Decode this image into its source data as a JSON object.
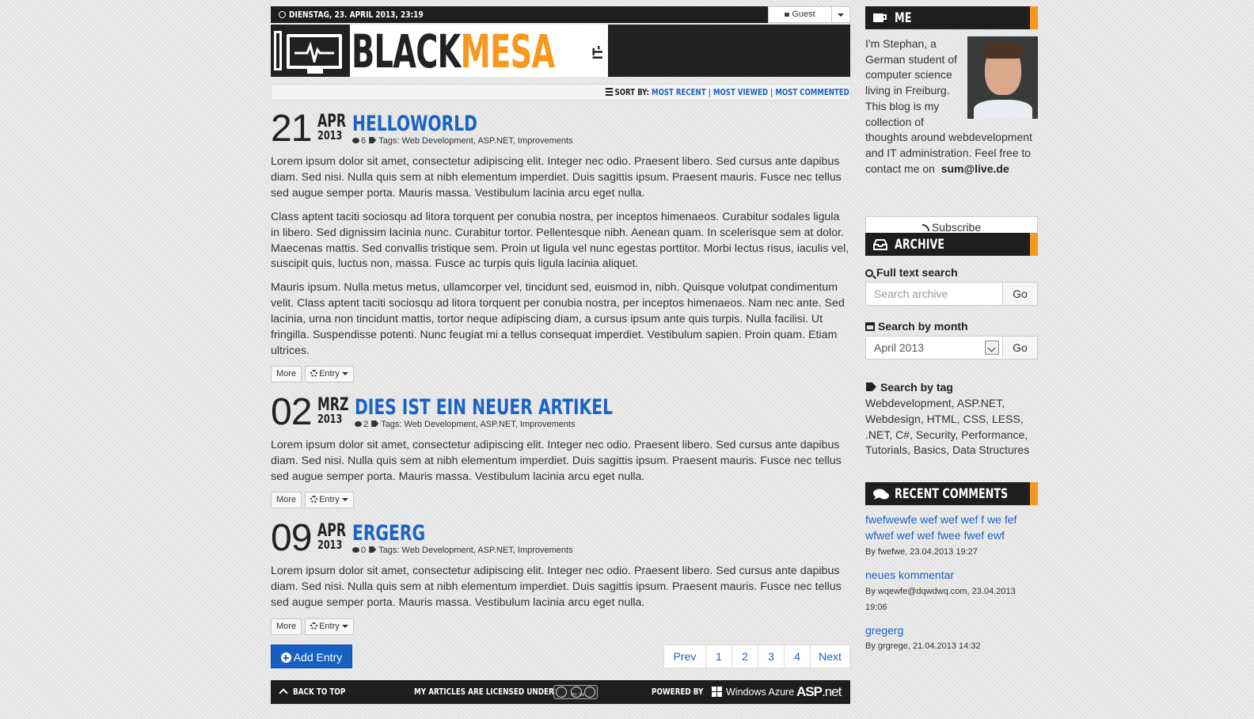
{
  "topbar": {
    "datetime": "DIENSTAG, 23. APRIL 2013, 23:19",
    "user": "Guest"
  },
  "logo": {
    "part1": "BLACK",
    "part2": "MESA",
    "tagline": "IT-BLOG"
  },
  "sort": {
    "label": "SORT BY:",
    "options": [
      "MOST RECENT",
      "MOST VIEWED",
      "MOST COMMENTED"
    ]
  },
  "posts": [
    {
      "day": "21",
      "month": "APR",
      "year": "2013",
      "title": "HELLOWORLD",
      "comments": "6",
      "tags_label": "Tags:",
      "tags": "Web Development, ASP.NET, Improvements",
      "paragraphs": [
        "Lorem ipsum dolor sit amet, consectetur adipiscing elit. Integer nec odio. Praesent libero. Sed cursus ante dapibus diam. Sed nisi. Nulla quis sem at nibh elementum imperdiet. Duis sagittis ipsum. Praesent mauris. Fusce nec tellus sed augue semper porta. Mauris massa. Vestibulum lacinia arcu eget nulla.",
        "Class aptent taciti sociosqu ad litora torquent per conubia nostra, per inceptos himenaeos. Curabitur sodales ligula in libero. Sed dignissim lacinia nunc. Curabitur tortor. Pellentesque nibh. Aenean quam. In scelerisque sem at dolor. Maecenas mattis. Sed convallis tristique sem. Proin ut ligula vel nunc egestas porttitor. Morbi lectus risus, iaculis vel, suscipit quis, luctus non, massa. Fusce ac turpis quis ligula lacinia aliquet.",
        "Mauris ipsum. Nulla metus metus, ullamcorper vel, tincidunt sed, euismod in, nibh. Quisque volutpat condimentum velit. Class aptent taciti sociosqu ad litora torquent per conubia nostra, per inceptos himenaeos. Nam nec ante. Sed lacinia, urna non tincidunt mattis, tortor neque adipiscing diam, a cursus ipsum ante quis turpis. Nulla facilisi. Ut fringilla. Suspendisse potenti. Nunc feugiat mi a tellus consequat imperdiet. Vestibulum sapien. Proin quam. Etiam ultrices."
      ],
      "more_label": "More",
      "entry_label": "Entry"
    },
    {
      "day": "02",
      "month": "MRZ",
      "year": "2013",
      "title": "DIES IST EIN NEUER ARTIKEL",
      "comments": "2",
      "tags_label": "Tags:",
      "tags": "Web Development, ASP.NET, Improvements",
      "paragraphs": [
        "Lorem ipsum dolor sit amet, consectetur adipiscing elit. Integer nec odio. Praesent libero. Sed cursus ante dapibus diam. Sed nisi. Nulla quis sem at nibh elementum imperdiet. Duis sagittis ipsum. Praesent mauris. Fusce nec tellus sed augue semper porta. Mauris massa. Vestibulum lacinia arcu eget nulla."
      ],
      "more_label": "More",
      "entry_label": "Entry"
    },
    {
      "day": "09",
      "month": "APR",
      "year": "2013",
      "title": "ERGERG",
      "comments": "0",
      "tags_label": "Tags:",
      "tags": "Web Development, ASP.NET, Improvements",
      "paragraphs": [
        "Lorem ipsum dolor sit amet, consectetur adipiscing elit. Integer nec odio. Praesent libero. Sed cursus ante dapibus diam. Sed nisi. Nulla quis sem at nibh elementum imperdiet. Duis sagittis ipsum. Praesent mauris. Fusce nec tellus sed augue semper porta. Mauris massa. Vestibulum lacinia arcu eget nulla."
      ],
      "more_label": "More",
      "entry_label": "Entry"
    }
  ],
  "add_entry": "Add Entry",
  "pager": [
    "Prev",
    "1",
    "2",
    "3",
    "4",
    "Next"
  ],
  "footer": {
    "back_to_top": "BACK TO TOP",
    "license": "MY ARTICLES ARE LICENSED UNDER",
    "powered": "POWERED BY",
    "azure": "Windows Azure",
    "asp": "ASP",
    "aspnet": ".net",
    "cc": "BY  SA"
  },
  "sidebar": {
    "me": {
      "heading": "ME",
      "about": "I'm Stephan, a German student of computer science living in Freiburg. This blog is my collection of thoughts around webdevelopment and IT administration. Feel free to contact me on",
      "email": "sum@live.de",
      "subscribe": "Subscribe"
    },
    "archive": {
      "heading": "ARCHIVE",
      "fulltext_label": "Full text search",
      "search_placeholder": "Search archive",
      "go": "Go",
      "month_label": "Search by month",
      "month_value": "April 2013",
      "tag_label": "Search by tag",
      "tags": "Webdevelopment, ASP.NET, Webdesign, HTML, CSS, LESS, .NET, C#, Security, Performance, Tutorials, Basics, Data Structures"
    },
    "comments": {
      "heading": "RECENT COMMENTS",
      "items": [
        {
          "text": "fwefwewfe wef wef wef f we fef wfwef wef wef fwee fwef ewf",
          "by": "By fwefwe, 23.04.2013 19:27"
        },
        {
          "text": "neues kommentar",
          "by": "By wqewfe@dqwdwq.com, 23.04.2013 19:06"
        },
        {
          "text": "gregerg",
          "by": "By grgrege, 21.04.2013 14:32"
        }
      ]
    }
  },
  "colors": {
    "accent": "#f8981d",
    "link": "#1a63c5",
    "dark": "#1e1e1e",
    "button": "#1660c4"
  }
}
